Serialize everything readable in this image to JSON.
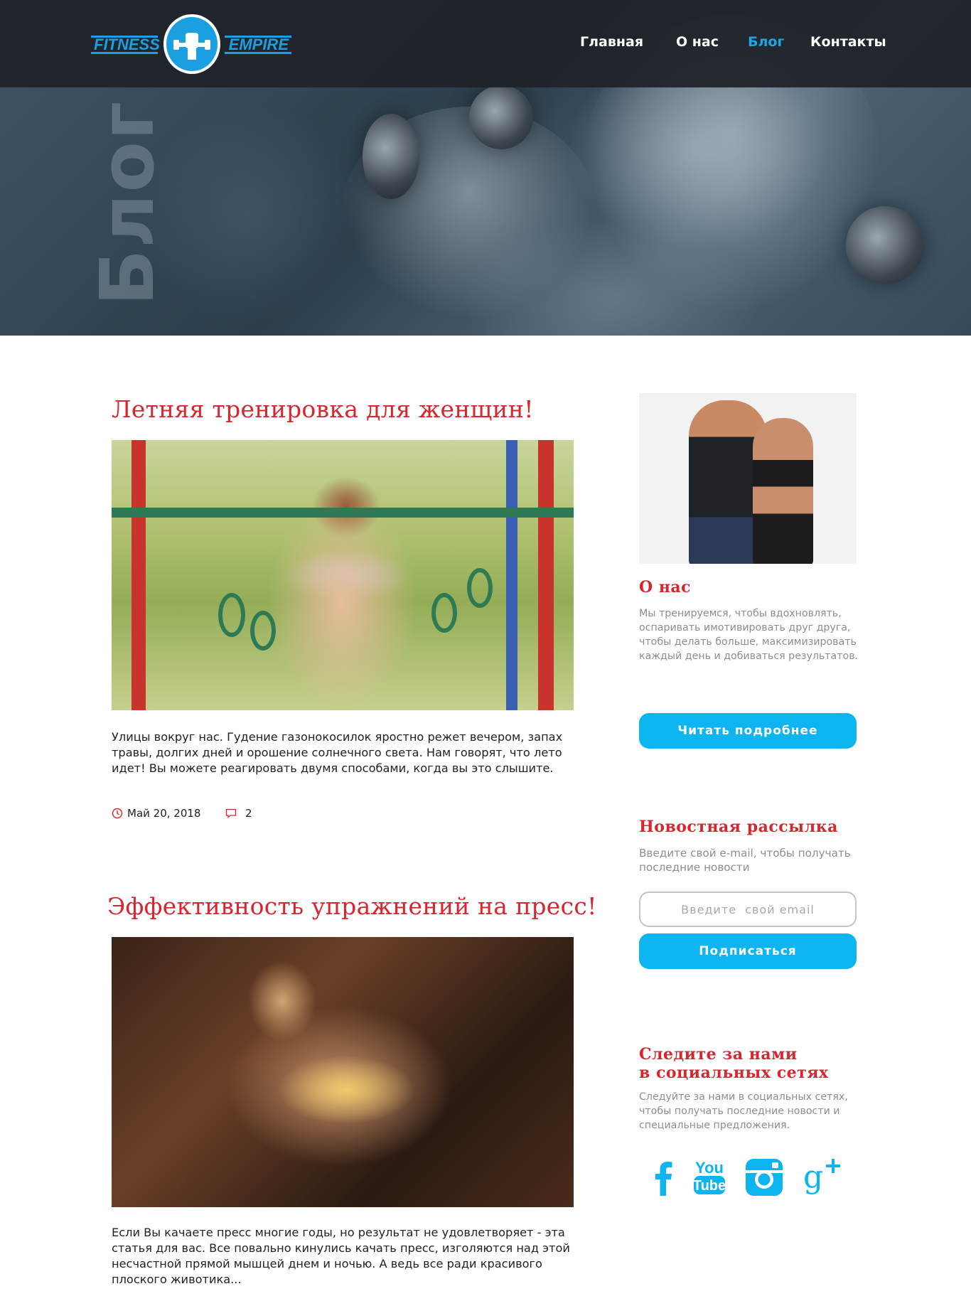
{
  "brand": {
    "left_word": "FITNESS",
    "right_word": "EMPIRE",
    "accent_color": "#1a9fe0"
  },
  "nav": {
    "items": [
      {
        "label": "Главная",
        "active": false
      },
      {
        "label": "О нас",
        "active": false
      },
      {
        "label": "Блог",
        "active": true
      },
      {
        "label": "Контакты",
        "active": false
      }
    ]
  },
  "hero": {
    "watermark": "Блог"
  },
  "articles": [
    {
      "title": "Летняя тренировка для женщин!",
      "text": "Улицы вокруг нас. Гудение газонокосилок яростно режет вечером, запах травы, долгих дней и орошение солнечного света. Нам говорят, что лето идет! Вы можете реагировать двумя способами, когда вы это слышите.",
      "date": "Май 20, 2018",
      "comments": "2"
    },
    {
      "title": "Эффективность упражнений на пресс!",
      "text": "Если Вы качаете пресс многие годы, но результат не удовлетворяет - эта статья для вас. Все повально кинулись качать пресс, изголяются над этой несчастной прямой мышцей днем и ночью. А ведь все ради красивого плоского животика..."
    }
  ],
  "sidebar": {
    "about": {
      "heading": "О нас",
      "text": "Мы тренируемся, чтобы вдохновлять, оспаривать имотивировать друг друга, чтобы делать больше, максимизировать каждый день и добиваться результатов.",
      "button": "Читать подробнее"
    },
    "newsletter": {
      "heading": "Новостная рассылка",
      "text": "Введите свой e-mail, чтобы получать последние новости",
      "placeholder": "Введите  свой email",
      "button": "Подписаться"
    },
    "social": {
      "heading_line1": "Следите за нами",
      "heading_line2": "в социальных сетях",
      "text": "Следуйте за нами в социальных сетях, чтобы получать последние новости и специальные предложения.",
      "icons": [
        "facebook-icon",
        "youtube-icon",
        "instagram-icon",
        "google-plus-icon"
      ],
      "icon_color": "#0cb4f0"
    }
  },
  "colors": {
    "title_red": "#d9252e",
    "button_blue": "#0cb4f0",
    "nav_active": "#1ba7e6"
  }
}
